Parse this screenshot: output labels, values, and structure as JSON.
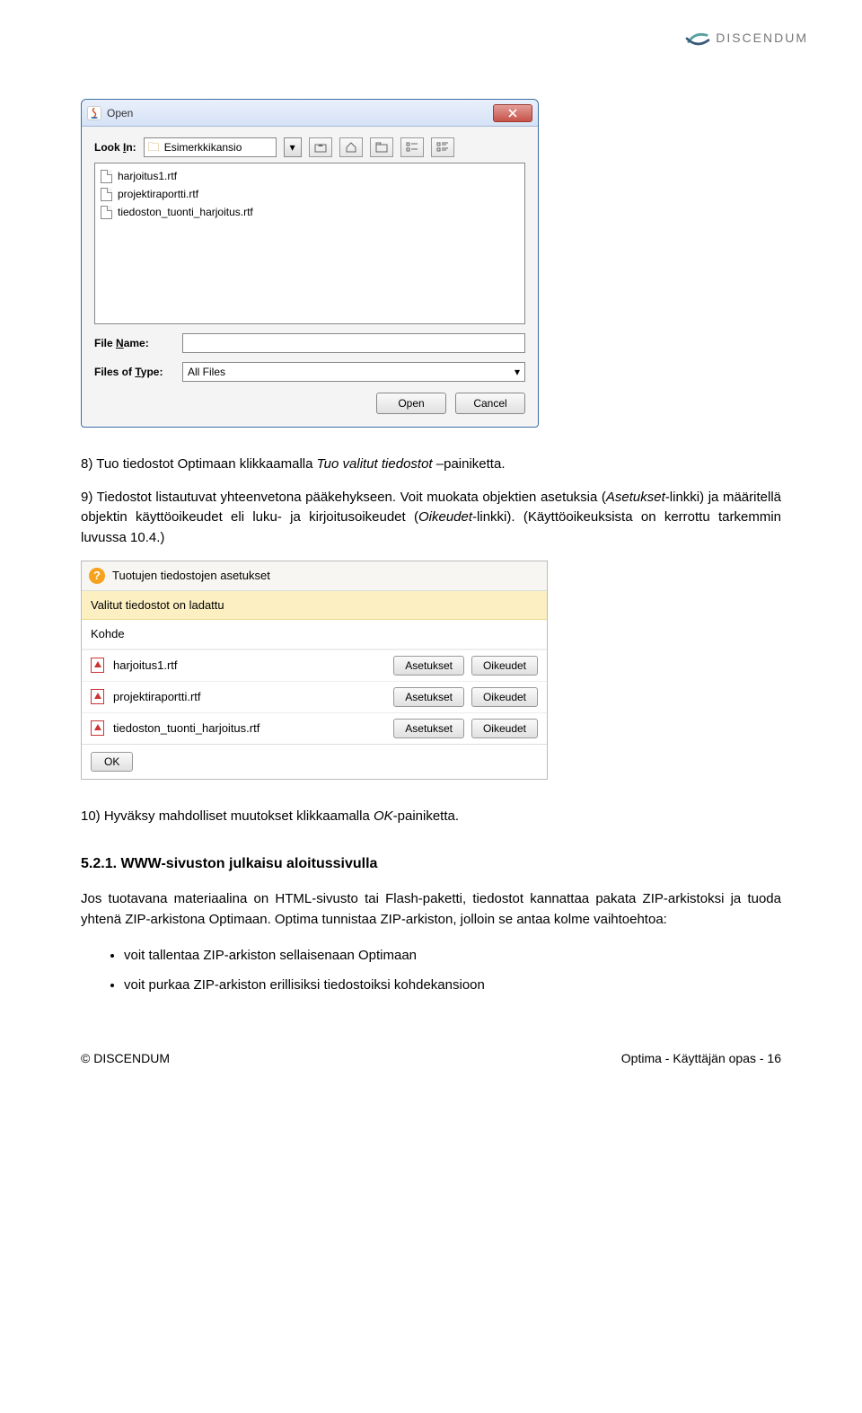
{
  "header": {
    "brand": "DISCENDUM"
  },
  "dialog": {
    "title": "Open",
    "lookin_label": "Look In:",
    "folder": "Esimerkkikansio",
    "files": [
      "harjoitus1.rtf",
      "projektiraportti.rtf",
      "tiedoston_tuonti_harjoitus.rtf"
    ],
    "filename_label": "File Name:",
    "filename_value": "",
    "filetype_label": "Files of Type:",
    "filetype_value": "All Files",
    "open_btn": "Open",
    "cancel_btn": "Cancel"
  },
  "p8_prefix": "8) Tuo tiedostot Optimaan klikkaamalla ",
  "p8_italic": "Tuo valitut tiedostot",
  "p8_suffix": " –painiketta.",
  "p9_prefix": "9) Tiedostot listautuvat yhteenvetona pääkehykseen. Voit muokata objektien asetuksia (",
  "p9_i1": "Asetukset",
  "p9_mid1": "-linkki) ja määritellä objektin käyttöoikeudet eli luku- ja kirjoitusoikeudet (",
  "p9_i2": "Oikeudet",
  "p9_suffix": "-linkki). (Käyttöoikeuksista on kerrottu tarkemmin luvussa 10.4.)",
  "settings": {
    "title": "Tuotujen tiedostojen asetukset",
    "status": "Valitut tiedostot on ladattu",
    "kohde": "Kohde",
    "rows": [
      {
        "name": "harjoitus1.rtf",
        "a": "Asetukset",
        "b": "Oikeudet"
      },
      {
        "name": "projektiraportti.rtf",
        "a": "Asetukset",
        "b": "Oikeudet"
      },
      {
        "name": "tiedoston_tuonti_harjoitus.rtf",
        "a": "Asetukset",
        "b": "Oikeudet"
      }
    ],
    "ok": "OK"
  },
  "p10_prefix": "10) Hyväksy mahdolliset muutokset klikkaamalla ",
  "p10_italic": "OK",
  "p10_suffix": "-painiketta.",
  "heading": "5.2.1. WWW-sivuston julkaisu aloitussivulla",
  "para_main": "Jos tuotavana materiaalina on HTML-sivusto tai Flash-paketti, tiedostot kannattaa pakata ZIP-arkistoksi ja tuoda yhtenä ZIP-arkistona Optimaan. Optima tunnistaa ZIP-arkiston, jolloin se antaa kolme vaihtoehtoa:",
  "bullets": [
    "voit tallentaa ZIP-arkiston sellaisenaan Optimaan",
    "voit purkaa ZIP-arkiston erillisiksi tiedostoiksi kohdekansioon"
  ],
  "footer": {
    "left": "© DISCENDUM",
    "right": "Optima - Käyttäjän opas - 16"
  }
}
